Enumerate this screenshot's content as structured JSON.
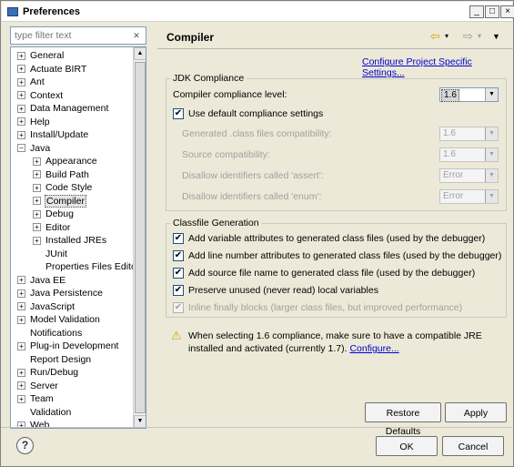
{
  "window": {
    "title": "Preferences"
  },
  "filter": {
    "placeholder": "type filter text"
  },
  "tree": {
    "items": [
      {
        "label": "General",
        "expander": "+"
      },
      {
        "label": "Actuate BIRT",
        "expander": "+"
      },
      {
        "label": "Ant",
        "expander": "+"
      },
      {
        "label": "Context",
        "expander": "+"
      },
      {
        "label": "Data Management",
        "expander": "+"
      },
      {
        "label": "Help",
        "expander": "+"
      },
      {
        "label": "Install/Update",
        "expander": "+"
      },
      {
        "label": "Java",
        "expander": "-"
      },
      {
        "label": "Appearance",
        "expander": "+"
      },
      {
        "label": "Build Path",
        "expander": "+"
      },
      {
        "label": "Code Style",
        "expander": "+"
      },
      {
        "label": "Compiler",
        "expander": "+"
      },
      {
        "label": "Debug",
        "expander": "+"
      },
      {
        "label": "Editor",
        "expander": "+"
      },
      {
        "label": "Installed JREs",
        "expander": "+"
      },
      {
        "label": "JUnit",
        "expander": ""
      },
      {
        "label": "Properties Files Editor",
        "expander": ""
      },
      {
        "label": "Java EE",
        "expander": "+"
      },
      {
        "label": "Java Persistence",
        "expander": "+"
      },
      {
        "label": "JavaScript",
        "expander": "+"
      },
      {
        "label": "Model Validation",
        "expander": "+"
      },
      {
        "label": "Notifications",
        "expander": ""
      },
      {
        "label": "Plug-in Development",
        "expander": "+"
      },
      {
        "label": "Report Design",
        "expander": ""
      },
      {
        "label": "Run/Debug",
        "expander": "+"
      },
      {
        "label": "Server",
        "expander": "+"
      },
      {
        "label": "Team",
        "expander": "+"
      },
      {
        "label": "Validation",
        "expander": ""
      },
      {
        "label": "Web",
        "expander": "+"
      }
    ]
  },
  "page": {
    "title": "Compiler",
    "configure_link": "Configure Project Specific Settings..."
  },
  "jdk": {
    "legend": "JDK Compliance",
    "compliance_label": "Compiler compliance level:",
    "compliance_value": "1.6",
    "use_default_label": "Use default compliance settings",
    "generated_label": "Generated .class files compatibility:",
    "generated_value": "1.6",
    "source_label": "Source compatibility:",
    "source_value": "1.6",
    "assert_label": "Disallow identifiers called 'assert':",
    "assert_value": "Error",
    "enum_label": "Disallow identifiers called 'enum':",
    "enum_value": "Error"
  },
  "classfile": {
    "legend": "Classfile Generation",
    "opt1": "Add variable attributes to generated class files (used by the debugger)",
    "opt2": "Add line number attributes to generated class files (used by the debugger)",
    "opt3": "Add source file name to generated class file (used by the debugger)",
    "opt4": "Preserve unused (never read) local variables",
    "opt5": "Inline finally blocks (larger class files, but improved performance)"
  },
  "warning": {
    "text": "When selecting 1.6 compliance, make sure to have a compatible JRE installed and activated (currently 1.7).",
    "link": "Configure..."
  },
  "buttons": {
    "restore": "Restore Defaults",
    "apply": "Apply",
    "ok": "OK",
    "cancel": "Cancel"
  },
  "colors": {
    "link": "#0000cc",
    "warning": "#d8a400"
  }
}
